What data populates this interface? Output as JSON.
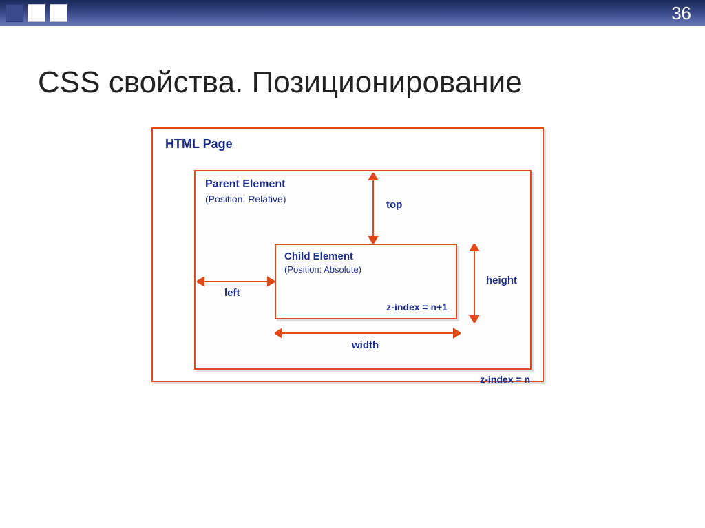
{
  "page_number": "36",
  "title": "CSS свойства. Позиционирование",
  "diagram": {
    "html_page_label": "HTML Page",
    "parent": {
      "label": "Parent Element",
      "sub": "(Position: Relative)",
      "zindex": "z-index = n"
    },
    "child": {
      "label": "Child Element",
      "sub": "(Position: Absolute)",
      "zindex": "z-index = n+1"
    },
    "dims": {
      "top": "top",
      "left": "left",
      "width": "width",
      "height": "height"
    }
  }
}
